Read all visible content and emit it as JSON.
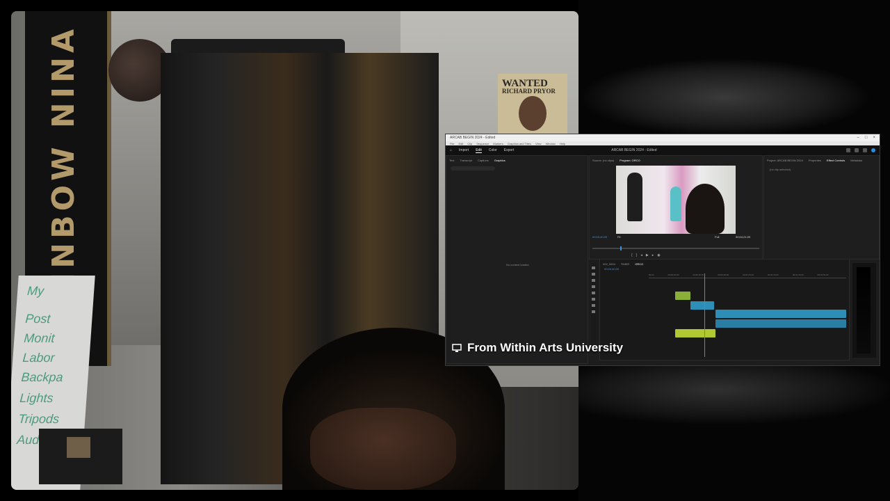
{
  "poster": {
    "title": "WANTED",
    "subtitle": "RICHARD PRYOR"
  },
  "banner": {
    "text": "RAINBOW NINA"
  },
  "whiteboard": {
    "lines": [
      "My",
      "Post",
      "Monit",
      "Labor",
      "Backpa",
      "Lights",
      "Tripods",
      "Audio"
    ]
  },
  "screen_share": {
    "app": {
      "menus": [
        "File",
        "Edit",
        "Clip",
        "Sequence",
        "Markers",
        "Graphics and Titles",
        "View",
        "Window",
        "Help"
      ],
      "workspace_tabs": [
        "Import",
        "Edit",
        "Color",
        "Export"
      ],
      "active_tab": "Edit",
      "project_title": "ARCAB BEGIN 2024 - Edited"
    },
    "left_panel": {
      "tabs": [
        "Text",
        "Transcript",
        "Captions",
        "Graphics"
      ],
      "active_tab": "Graphics",
      "placeholder": "No content loaded",
      "search_placeholder": ""
    },
    "program_monitor": {
      "tabs": [
        "Source: (no clips)",
        "Program: ORCO"
      ],
      "timecode_current": "00;00;40;09",
      "timecode_duration": "00;04;21;09",
      "fit": "Fit",
      "quality": "Full"
    },
    "right_panel": {
      "tabs": [
        "Project: ARCAB BEGIN 2024",
        "Properties",
        "Effect Controls",
        "Metadata"
      ],
      "active_tab": "Effect Controls",
      "content": "(no clip selected)"
    },
    "timeline": {
      "sequence_tabs": [
        "002_0004",
        "TIMER",
        "ORCO"
      ],
      "timecode": "00;00;40;09",
      "ruler_marks": [
        "00;00",
        "00;00;16;00",
        "00;00;32;00",
        "00;00;48;00",
        "00;01;04;00",
        "00;01;20;02",
        "00;01;36;00",
        "00;01;52;02"
      ],
      "video_color": "#2d8fb8",
      "audio_color": "#b0c832"
    }
  },
  "caption": {
    "text": "From Within Arts University",
    "icon": "monitor-icon"
  }
}
